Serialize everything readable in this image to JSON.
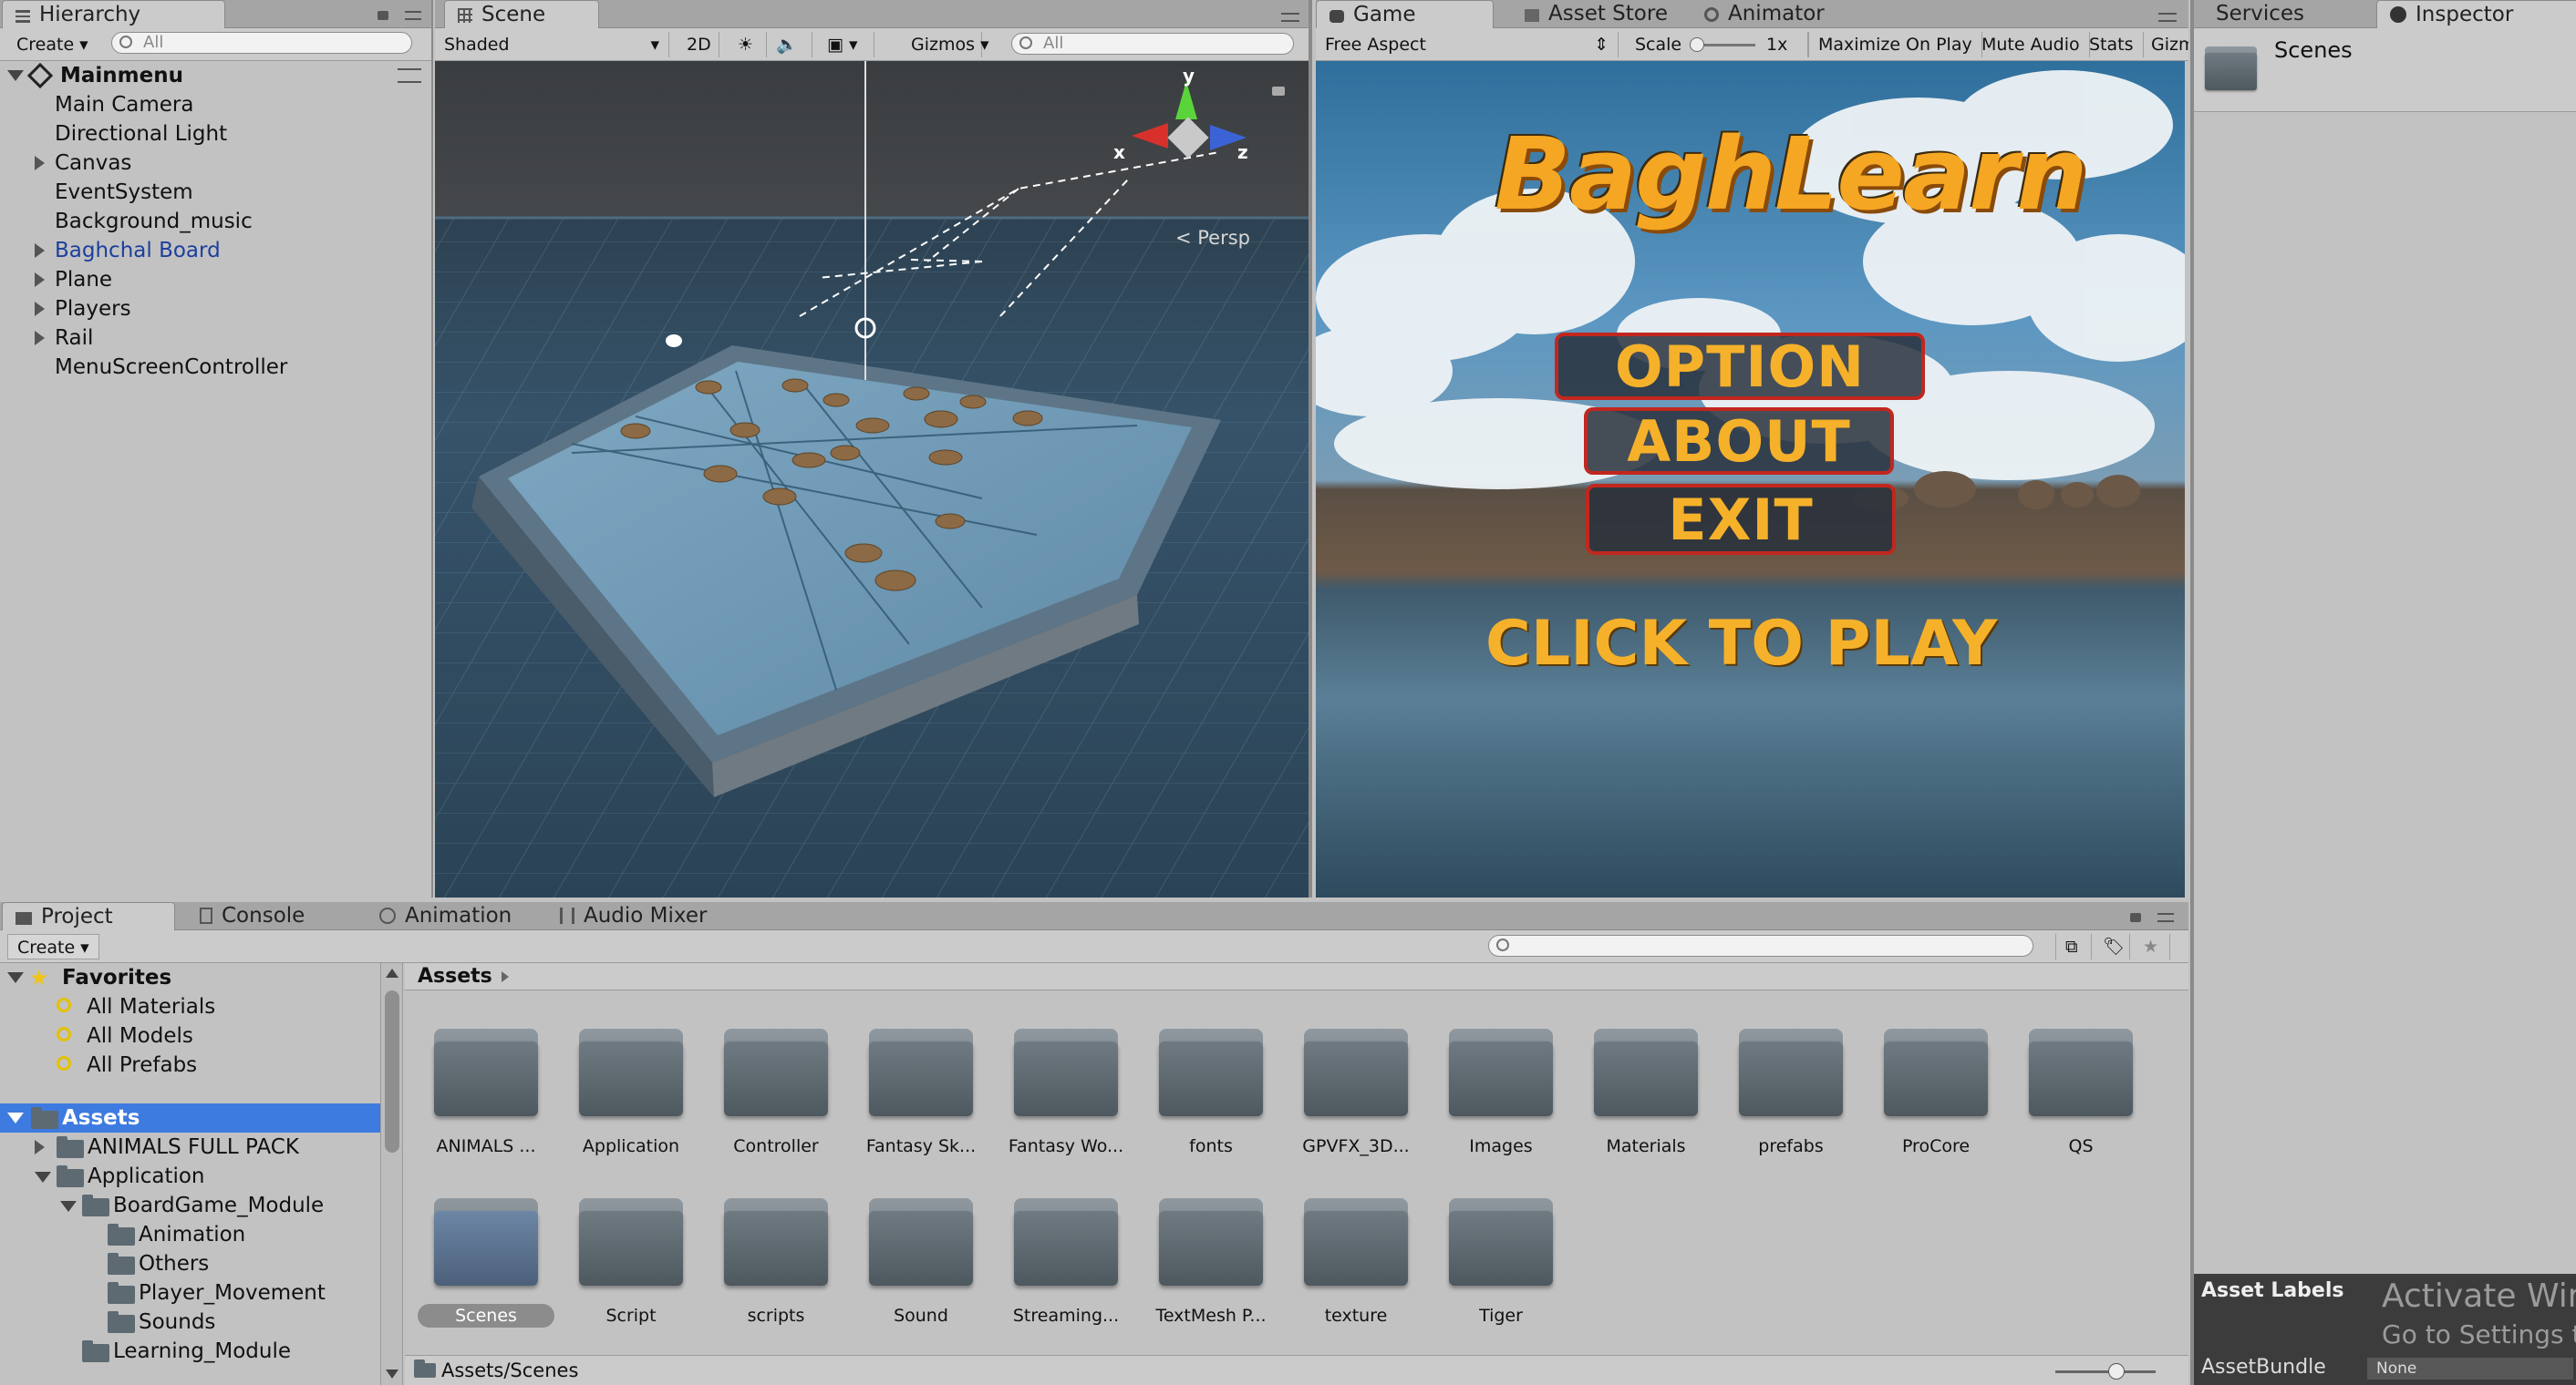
{
  "hierarchy": {
    "tab": "Hierarchy",
    "create_label": "Create",
    "search_placeholder": "All",
    "scene_name": "Mainmenu",
    "items": [
      {
        "label": "Main Camera",
        "expandable": false
      },
      {
        "label": "Directional Light",
        "expandable": false
      },
      {
        "label": "Canvas",
        "expandable": true
      },
      {
        "label": "EventSystem",
        "expandable": false
      },
      {
        "label": "Background_music",
        "expandable": false
      },
      {
        "label": "Baghchal Board",
        "expandable": true,
        "color": "#1c3f9c"
      },
      {
        "label": "Plane",
        "expandable": true
      },
      {
        "label": "Players",
        "expandable": true
      },
      {
        "label": "Rail",
        "expandable": true
      },
      {
        "label": "MenuScreenController",
        "expandable": false
      }
    ]
  },
  "scene": {
    "tab": "Scene",
    "shading": "Shaded",
    "mode_2d": "2D",
    "gizmos": "Gizmos",
    "search_placeholder": "All",
    "persp_label": "< Persp",
    "axis_y": "y",
    "axis_x": "x",
    "axis_z": "z"
  },
  "game": {
    "tabs": [
      "Game",
      "Asset Store",
      "Animator"
    ],
    "aspect": "Free Aspect",
    "scale_label": "Scale",
    "scale_value": "1x",
    "maximize": "Maximize On Play",
    "mute": "Mute Audio",
    "stats": "Stats",
    "gizmos": "Gizm",
    "title": "BaghLearn",
    "buttons": [
      "OPTION",
      "ABOUT",
      "EXIT"
    ],
    "cta": "CLICK TO PLAY"
  },
  "right_tabs": {
    "services": "Services",
    "inspector": "Inspector",
    "selected": "Scenes"
  },
  "asset_labels": {
    "title": "Asset Labels",
    "bundle_label": "AssetBundle",
    "bundle_value": "None",
    "watermark_1": "Activate Win",
    "watermark_2": "Go to Settings to"
  },
  "project": {
    "tabs": [
      "Project",
      "Console",
      "Animation",
      "Audio Mixer"
    ],
    "create_label": "Create",
    "favorites_label": "Favorites",
    "favorites": [
      "All Materials",
      "All Models",
      "All Prefabs"
    ],
    "assets_label": "Assets",
    "tree": [
      {
        "label": "ANIMALS FULL PACK",
        "indent": 1,
        "arrow": "r"
      },
      {
        "label": "Application",
        "indent": 1,
        "arrow": "d"
      },
      {
        "label": "BoardGame_Module",
        "indent": 2,
        "arrow": "d"
      },
      {
        "label": "Animation",
        "indent": 3,
        "arrow": ""
      },
      {
        "label": "Others",
        "indent": 3,
        "arrow": ""
      },
      {
        "label": "Player_Movement",
        "indent": 3,
        "arrow": ""
      },
      {
        "label": "Sounds",
        "indent": 3,
        "arrow": ""
      },
      {
        "label": "Learning_Module",
        "indent": 2,
        "arrow": ""
      }
    ],
    "breadcrumb": "Assets",
    "folders_row1": [
      "ANIMALS ...",
      "Application",
      "Controller",
      "Fantasy Sk...",
      "Fantasy Wo...",
      "fonts",
      "GPVFX_3D...",
      "Images",
      "Materials",
      "prefabs",
      "ProCore",
      "QS"
    ],
    "folders_row2": [
      "Scenes",
      "Script",
      "scripts",
      "Sound",
      "Streaming...",
      "TextMesh P...",
      "texture",
      "Tiger"
    ],
    "selected_folder": "Scenes",
    "status_path": "Assets/Scenes"
  },
  "colors": {
    "selection_blue": "#3d7be0",
    "accent_orange": "#f6b12a",
    "button_border": "#c1271f"
  }
}
